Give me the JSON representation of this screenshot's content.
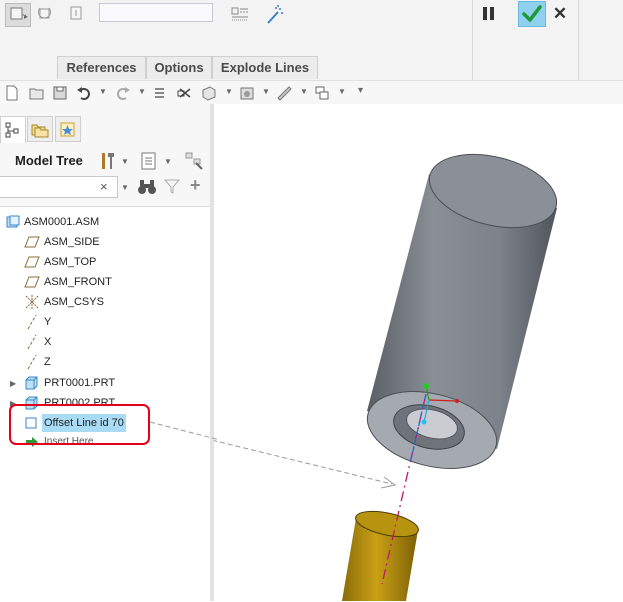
{
  "dashboard": {
    "name_field_value": "",
    "tabs": [
      {
        "label": "References"
      },
      {
        "label": "Options"
      },
      {
        "label": "Explode Lines"
      }
    ],
    "ok_label": "OK",
    "cancel_label": "Cancel",
    "pause_label": "Pause"
  },
  "colors": {
    "ok_button": "#8fd0ef",
    "selection": "#a9dbf5",
    "highlight_box": "#e3001b",
    "cylinder_body": "#7a7f87",
    "cylinder_face": "#9ca1a8",
    "part_gold": "#b6900c"
  },
  "quick_access": {
    "icons": [
      "new-icon",
      "open-icon",
      "save-icon",
      "undo-icon",
      "redo-icon",
      "regenerate-icon",
      "close-window-icon",
      "display-style-icon",
      "view-manager-icon",
      "measure-icon",
      "windows-icon",
      "customize-icon"
    ]
  },
  "left_panel": {
    "title": "Model Tree",
    "search_placeholder": "",
    "tree": [
      {
        "label": "ASM0001.ASM",
        "icon": "assembly-icon"
      },
      {
        "label": "ASM_SIDE",
        "icon": "datum-plane-icon"
      },
      {
        "label": "ASM_TOP",
        "icon": "datum-plane-icon"
      },
      {
        "label": "ASM_FRONT",
        "icon": "datum-plane-icon"
      },
      {
        "label": "ASM_CSYS",
        "icon": "csys-icon"
      },
      {
        "label": "Y",
        "icon": "datum-axis-icon"
      },
      {
        "label": "X",
        "icon": "datum-axis-icon"
      },
      {
        "label": "Z",
        "icon": "datum-axis-icon"
      },
      {
        "label": "PRT0001.PRT",
        "icon": "part-icon"
      },
      {
        "label": "PRT0002.PRT",
        "icon": "part-icon"
      },
      {
        "label": "Offset Line id 70",
        "icon": "offset-line-icon",
        "selected": true
      },
      {
        "label": "Insert Here",
        "icon": "insert-arrow-icon"
      }
    ]
  }
}
